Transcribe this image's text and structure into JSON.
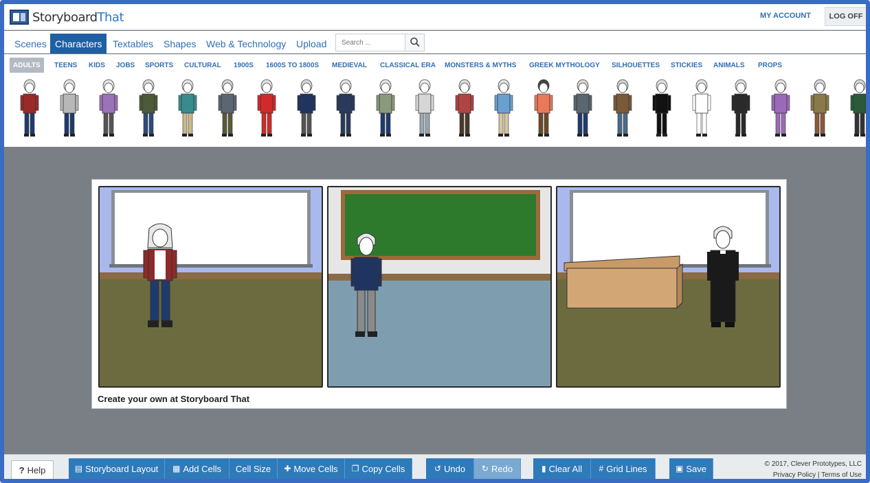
{
  "app": {
    "logo_word1": "Storyboard",
    "logo_word2": "That",
    "my_account": "MY ACCOUNT",
    "log_off": "LOG OFF"
  },
  "tabs": [
    {
      "label": "Scenes"
    },
    {
      "label": "Characters"
    },
    {
      "label": "Textables"
    },
    {
      "label": "Shapes"
    },
    {
      "label": "Web & Technology"
    },
    {
      "label": "Upload"
    }
  ],
  "search": {
    "placeholder": "Search ..."
  },
  "categories": [
    {
      "label": "ADULTS"
    },
    {
      "label": "TEENS"
    },
    {
      "label": "KIDS"
    },
    {
      "label": "JOBS"
    },
    {
      "label": "SPORTS"
    },
    {
      "label": "CULTURAL"
    },
    {
      "label": "1900S"
    },
    {
      "label": "1600S TO 1800S"
    },
    {
      "label": "MEDIEVAL"
    },
    {
      "label": "CLASSICAL ERA"
    },
    {
      "label": "MONSTERS & MYTHS"
    },
    {
      "label": "GREEK MYTHOLOGY"
    },
    {
      "label": "SILHOUETTES"
    },
    {
      "label": "STICKIES"
    },
    {
      "label": "ANIMALS"
    },
    {
      "label": "PROPS"
    }
  ],
  "characters": [
    {
      "top": "#9a2a2a",
      "bottom": "#1f3a6e",
      "hair": "#dcdcdc"
    },
    {
      "top": "#b8b8b8",
      "bottom": "#1f3a6e",
      "hair": "#e2e2e2"
    },
    {
      "top": "#9b73b8",
      "bottom": "#555555",
      "hair": "#e2e2e2"
    },
    {
      "top": "#4c5a3a",
      "bottom": "#2f4a7a",
      "hair": "#d8d8d8"
    },
    {
      "top": "#3a8c8c",
      "bottom": "#c9b98a",
      "hair": "#e2e2e2"
    },
    {
      "top": "#5d6670",
      "bottom": "#5a5a3a",
      "hair": "#d0d0d0"
    },
    {
      "top": "#d12a2a",
      "bottom": "#d12a2a",
      "hair": "#e2e2e2"
    },
    {
      "top": "#1f3560",
      "bottom": "#555555",
      "hair": "#d6d6d6"
    },
    {
      "top": "#2a3a5c",
      "bottom": "#2a3a5c",
      "hair": "#e2e2e2"
    },
    {
      "top": "#8a9a7a",
      "bottom": "#1f3a6e",
      "hair": "#e2e2e2"
    },
    {
      "top": "#d6d6d6",
      "bottom": "#9aa6b0",
      "hair": "#ededed"
    },
    {
      "top": "#b04444",
      "bottom": "#4a3a2a",
      "hair": "#dcdcdc"
    },
    {
      "top": "#6aa0d0",
      "bottom": "#d4c6a0",
      "hair": "#e2e2e2"
    },
    {
      "top": "#e87a5a",
      "bottom": "#6a4a2a",
      "hair": "#444444"
    },
    {
      "top": "#5a6670",
      "bottom": "#1f3a6e",
      "hair": "#d6d6d6"
    },
    {
      "top": "#7a5a3a",
      "bottom": "#4a6a8a",
      "hair": "#d0d0d0"
    },
    {
      "top": "#111111",
      "bottom": "#111111",
      "hair": "#e2e2e2"
    },
    {
      "top": "#ffffff",
      "bottom": "#ffffff",
      "hair": "#e2e2e2"
    },
    {
      "top": "#2a2a2a",
      "bottom": "#2a2a2a",
      "hair": "#dcdcdc"
    },
    {
      "top": "#9a6ab8",
      "bottom": "#9a6ab8",
      "hair": "#e2e2e2"
    },
    {
      "top": "#8a7a4a",
      "bottom": "#8a5a3a",
      "hair": "#d6d6d6"
    },
    {
      "top": "#2a5a3a",
      "bottom": "#333333",
      "hair": "#d6d6d6"
    }
  ],
  "board": {
    "caption": "Create your own at Storyboard That"
  },
  "toolbar": {
    "help": "Help",
    "storyboard_layout": "Storyboard Layout",
    "add_cells": "Add Cells",
    "cell_size": "Cell Size",
    "move_cells": "Move Cells",
    "copy_cells": "Copy Cells",
    "undo": "Undo",
    "redo": "Redo",
    "clear_all": "Clear All",
    "grid_lines": "Grid Lines",
    "save": "Save"
  },
  "footer": {
    "copyright": "© 2017, Clever Prototypes, LLC",
    "privacy": "Privacy Policy",
    "separator": "|",
    "terms": "Terms of Use"
  }
}
